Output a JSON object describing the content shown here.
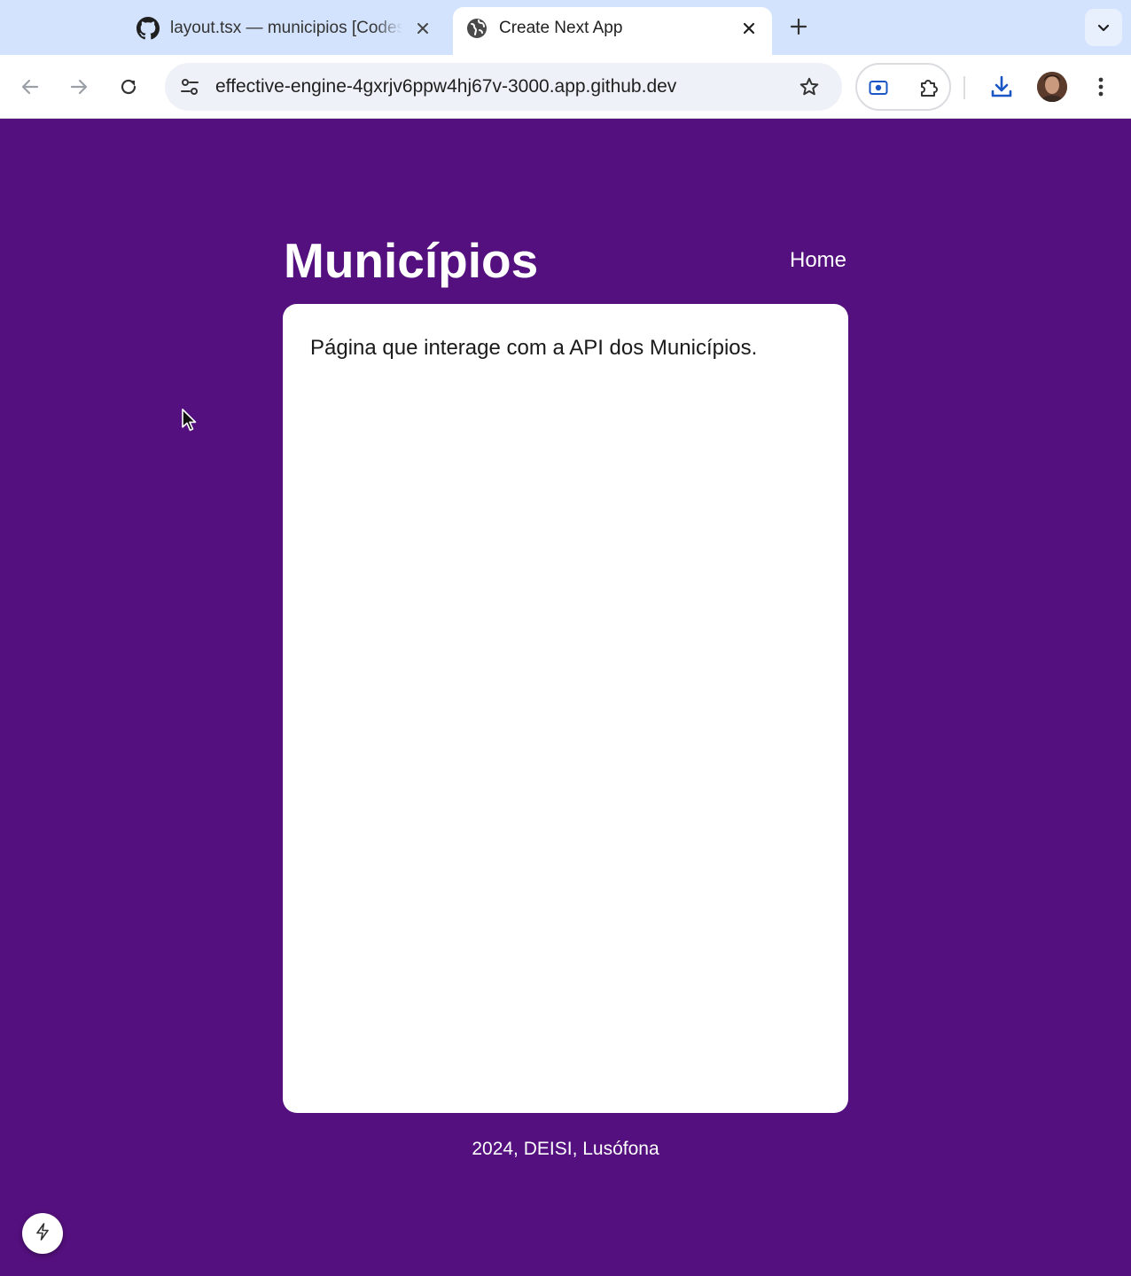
{
  "browser": {
    "tabs": [
      {
        "title": "layout.tsx — municipios [Codespaces]",
        "favicon": "github-icon",
        "active": false
      },
      {
        "title": "Create Next App",
        "favicon": "globe-icon",
        "active": true
      }
    ],
    "url": "effective-engine-4gxrjv6ppw4hj67v-3000.app.github.dev"
  },
  "page": {
    "title": "Municípios",
    "nav": {
      "home_label": "Home"
    },
    "card_text": "Página que interage com a API dos Municípios.",
    "footer": "2024, DEISI, Lusófona"
  },
  "colors": {
    "page_background": "#54107e",
    "card_background": "#ffffff",
    "tabstrip": "#d3e3fd",
    "download_accent": "#1a56c4"
  },
  "icons": [
    "github-icon",
    "globe-icon",
    "close-icon",
    "plus-icon",
    "chevron-down-icon",
    "back-arrow-icon",
    "forward-arrow-icon",
    "reload-icon",
    "site-settings-icon",
    "star-icon",
    "screencast-icon",
    "extensions-puzzle-icon",
    "download-icon",
    "kebab-menu-icon",
    "lightning-icon",
    "mouse-cursor-icon"
  ]
}
